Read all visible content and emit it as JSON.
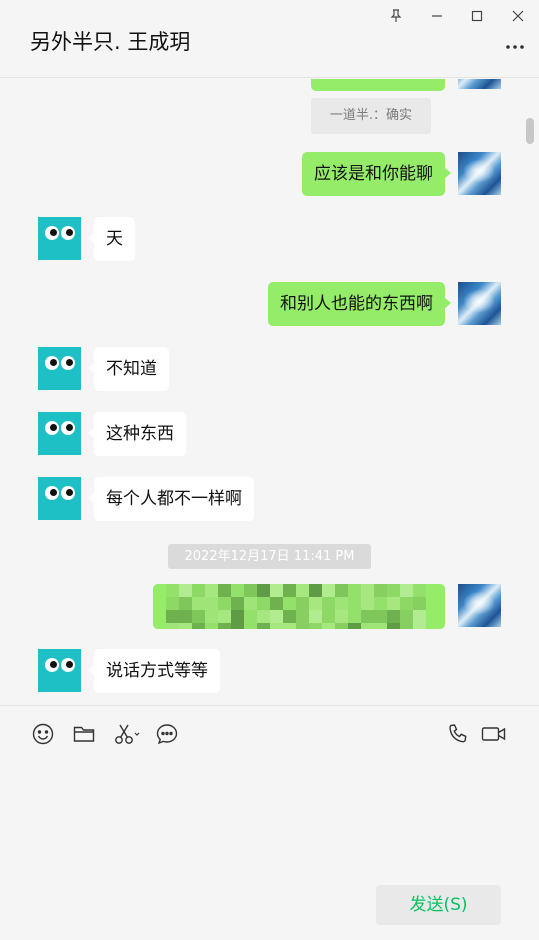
{
  "window": {
    "title": "另外半只. 王成玥",
    "controls": [
      "pin-icon",
      "minimize-icon",
      "maximize-icon",
      "close-icon",
      "more-icon"
    ]
  },
  "chat": {
    "recall_notice": "一道半.：确实",
    "timestamp": "2022年12月17日 11:41 PM",
    "messages": [
      {
        "sender": "me",
        "text": "应该是和你能聊"
      },
      {
        "sender": "other",
        "text": "天"
      },
      {
        "sender": "me",
        "text": "和别人也能的东西啊"
      },
      {
        "sender": "other",
        "text": "不知道"
      },
      {
        "sender": "other",
        "text": "这种东西"
      },
      {
        "sender": "other",
        "text": "每个人都不一样啊"
      },
      {
        "sender": "me",
        "text": ""
      },
      {
        "sender": "other",
        "text": "说话方式等等"
      }
    ]
  },
  "toolbar": {
    "left_tools": [
      "emoji-icon",
      "folder-icon",
      "scissors-icon",
      "chat-history-icon"
    ],
    "right_tools": [
      "voice-call-icon",
      "video-call-icon"
    ]
  },
  "composer": {
    "send_label": "发送(S)"
  },
  "colors": {
    "my_bubble": "#95ec69",
    "their_bubble": "#ffffff",
    "background": "#f5f5f5",
    "send_text": "#07c160",
    "avatar_other": "#1ec0c6"
  }
}
